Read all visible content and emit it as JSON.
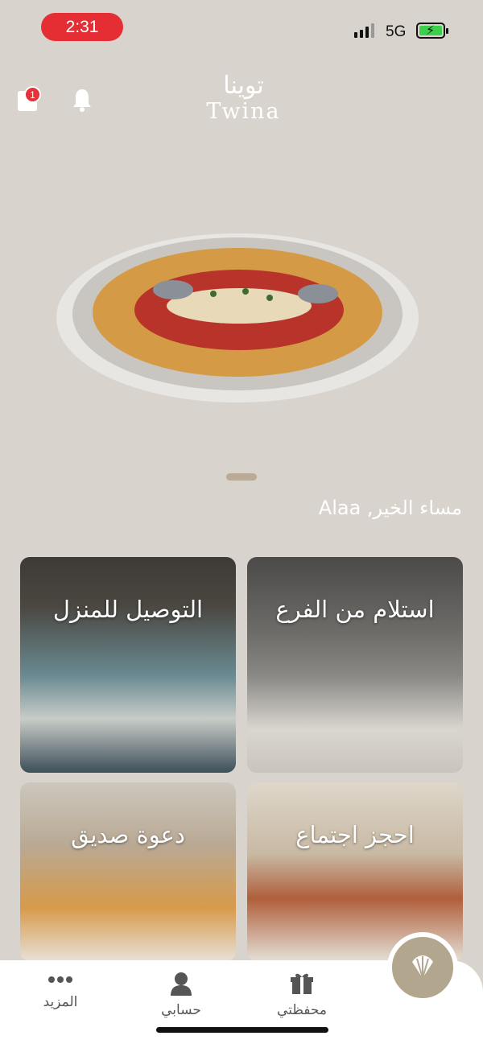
{
  "status": {
    "time": "2:31",
    "network": "5G"
  },
  "header": {
    "cart_count": "1",
    "logo_ar": "توينا",
    "logo_en": "Twina"
  },
  "greeting": "مساء الخير, Alaa",
  "cards": [
    {
      "title": "التوصيل للمنزل"
    },
    {
      "title": "استلام من الفرع"
    },
    {
      "title": "دعوة صديق"
    },
    {
      "title": "احجز اجتماع"
    }
  ],
  "nav": {
    "more": "المزيد",
    "account": "حسابي",
    "wallet": "محفظتي"
  },
  "colors": {
    "accent": "#b3a68f",
    "badge": "#e5323b",
    "time_pill": "#e52d34",
    "background": "#d8d3cc"
  }
}
